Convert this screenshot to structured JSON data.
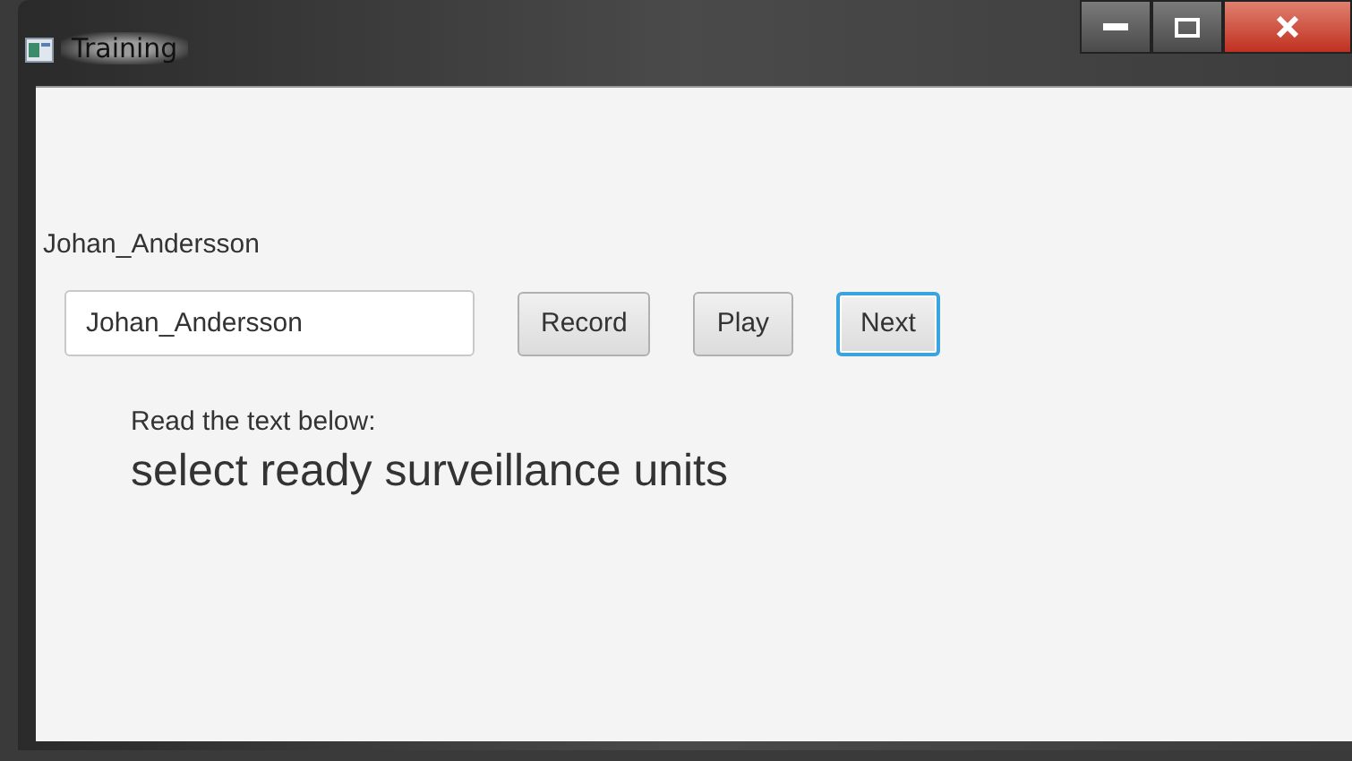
{
  "window": {
    "title": "Training"
  },
  "user_label": "Johan_Andersson",
  "name_field": {
    "value": "Johan_Andersson"
  },
  "buttons": [
    {
      "label": "Record",
      "focused": false
    },
    {
      "label": "Play",
      "focused": false
    },
    {
      "label": "Next",
      "focused": true
    }
  ],
  "instruction": "Read the text below:",
  "prompt": "select ready surveillance units"
}
